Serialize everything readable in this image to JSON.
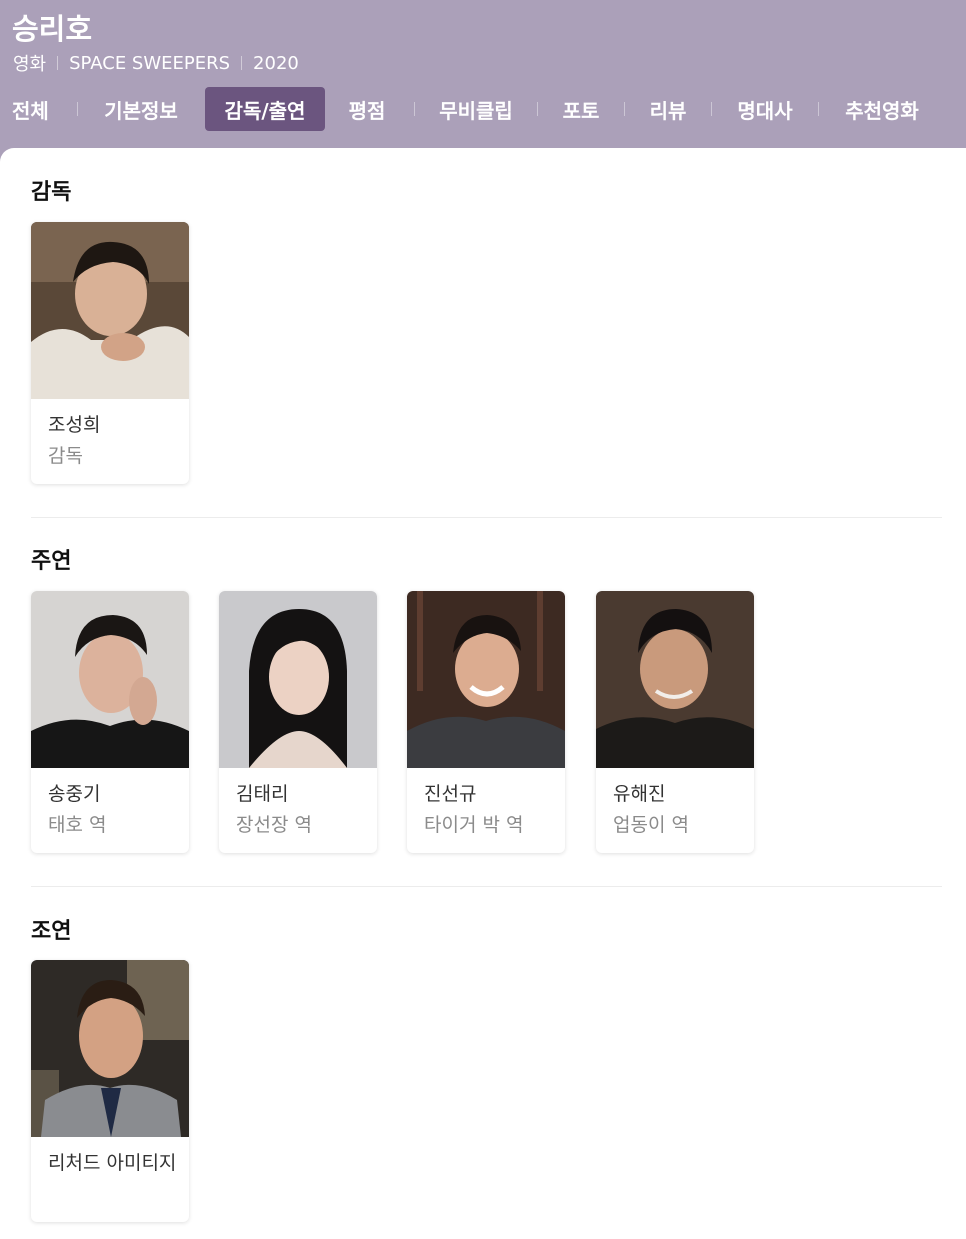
{
  "header": {
    "title": "승리호",
    "meta": [
      "영화",
      "SPACE SWEEPERS",
      "2020"
    ],
    "tabs": [
      "전체",
      "기본정보",
      "감독/출연",
      "평점",
      "무비클립",
      "포토",
      "리뷰",
      "명대사",
      "추천영화"
    ],
    "active_tab": "감독/출연"
  },
  "colors": {
    "header_bg": "#aba0b9",
    "active_tab_bg": "#6b557f"
  },
  "sections": {
    "director": {
      "title": "감독",
      "people": [
        {
          "name": "조성희",
          "role": "감독",
          "photo": "portrait-photo"
        }
      ]
    },
    "lead": {
      "title": "주연",
      "people": [
        {
          "name": "송중기",
          "role": "태호 역",
          "photo": "portrait-photo"
        },
        {
          "name": "김태리",
          "role": "장선장 역",
          "photo": "portrait-photo"
        },
        {
          "name": "진선규",
          "role": "타이거 박 역",
          "photo": "portrait-photo"
        },
        {
          "name": "유해진",
          "role": "업동이 역",
          "photo": "portrait-photo"
        }
      ]
    },
    "supporting": {
      "title": "조연",
      "people": [
        {
          "name": "리처드 아미티지",
          "role": "",
          "photo": "portrait-photo"
        }
      ]
    }
  }
}
